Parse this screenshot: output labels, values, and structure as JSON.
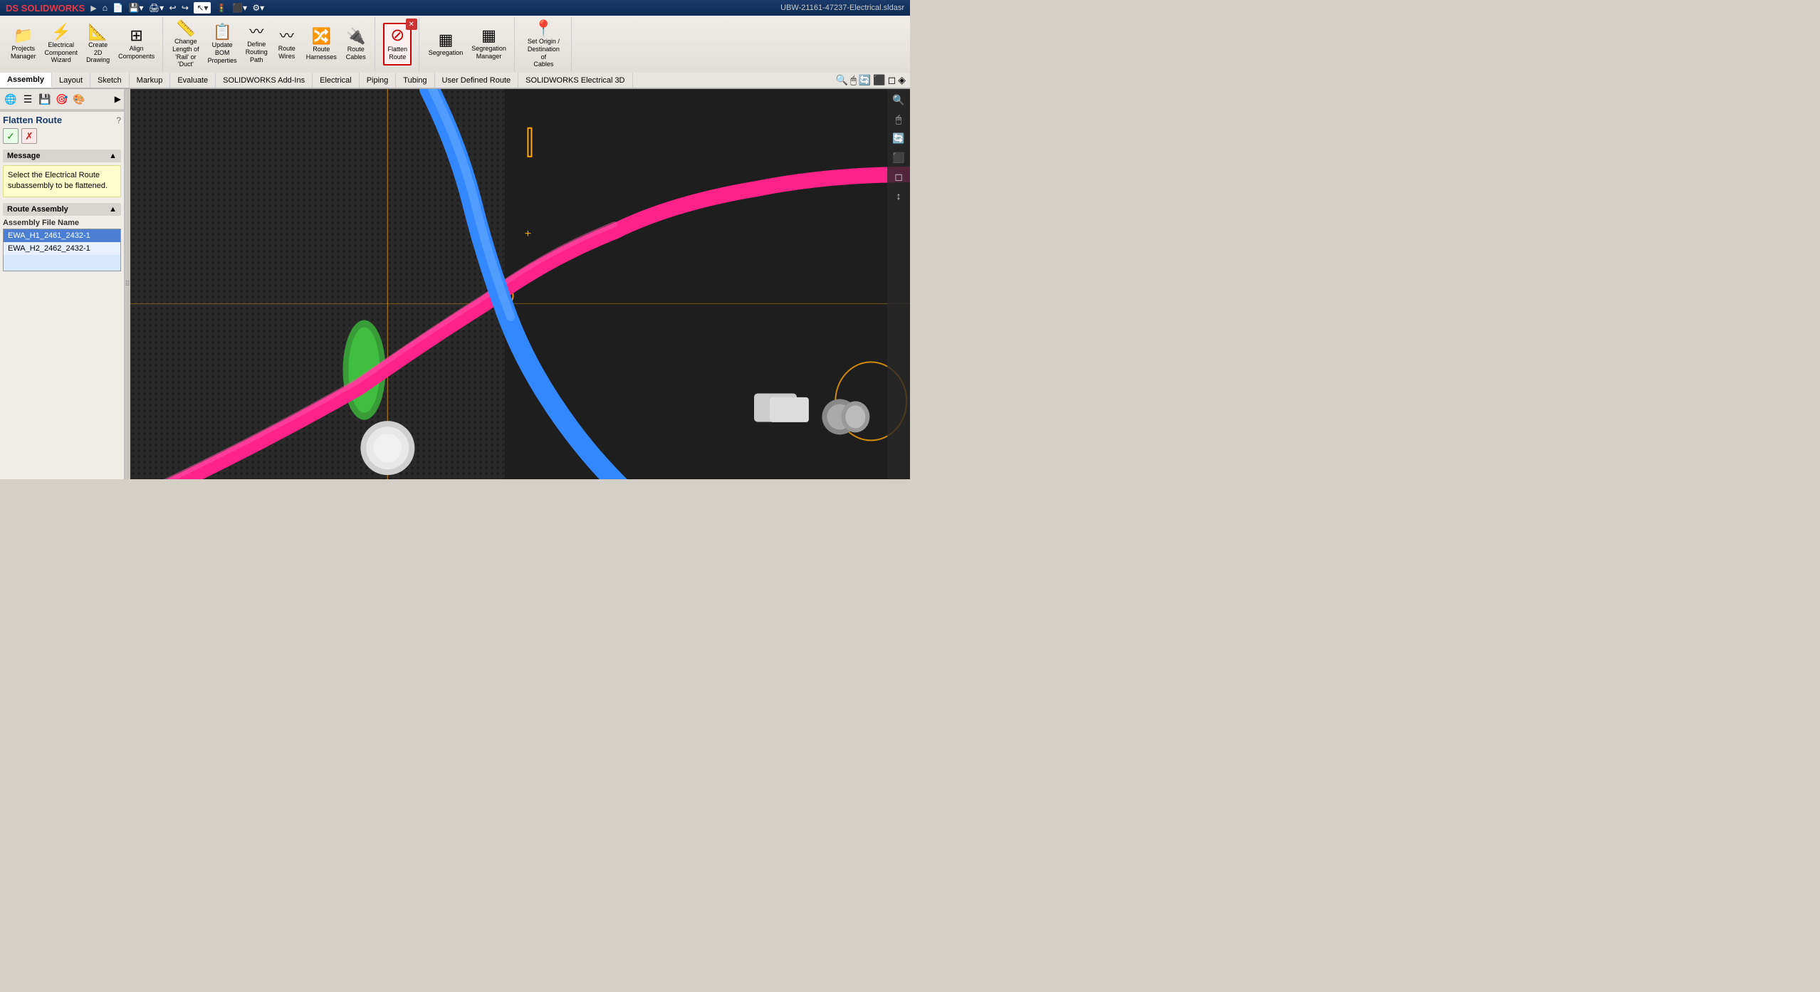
{
  "titlebar": {
    "logo": "DS SOLIDWORKS",
    "filename": "UBW-21161-47237-Electrical.sldasr",
    "nav_arrow": "▶"
  },
  "quick_access": {
    "buttons": [
      "⌂",
      "📄",
      "💾",
      "🖨",
      "↩",
      "↪"
    ]
  },
  "ribbon": {
    "groups": [
      {
        "id": "projects",
        "buttons": [
          {
            "label": "Projects\nManager",
            "icon": "📁"
          },
          {
            "label": "Electrical\nComponent\nWizard",
            "icon": "⚡"
          },
          {
            "label": "Create\n2D\nDrawing",
            "icon": "📐"
          },
          {
            "label": "Align\nComponents",
            "icon": "🔲"
          }
        ]
      },
      {
        "id": "route",
        "buttons": [
          {
            "label": "Change\nLength of\n'Rail' or\n'Duct'",
            "icon": "📏"
          },
          {
            "label": "Update\nBOM\nProperties",
            "icon": "📋"
          },
          {
            "label": "Define\nRouting\nPath",
            "icon": "〰"
          },
          {
            "label": "Route\nWires",
            "icon": "〰"
          },
          {
            "label": "Route\nHarnesses",
            "icon": "🔀"
          },
          {
            "label": "Route\nCables",
            "icon": "🔌"
          }
        ]
      },
      {
        "id": "flatten",
        "buttons": [
          {
            "label": "Flatten\nRoute",
            "icon": "⊘",
            "highlighted": true
          }
        ]
      },
      {
        "id": "segregation",
        "buttons": [
          {
            "label": "Segregation",
            "icon": "▦"
          },
          {
            "label": "Segregation\nManager",
            "icon": "▦"
          }
        ]
      },
      {
        "id": "origin",
        "buttons": [
          {
            "label": "Set Origin /\nDestination of Cables",
            "icon": "📍"
          }
        ]
      }
    ]
  },
  "ribbon_tabs": [
    {
      "label": "Assembly",
      "active": true
    },
    {
      "label": "Layout"
    },
    {
      "label": "Sketch"
    },
    {
      "label": "Markup"
    },
    {
      "label": "Evaluate"
    },
    {
      "label": "SOLIDWORKS Add-Ins"
    },
    {
      "label": "Electrical"
    },
    {
      "label": "Piping"
    },
    {
      "label": "Tubing"
    },
    {
      "label": "User Defined Route"
    },
    {
      "label": "SOLIDWORKS Electrical 3D"
    }
  ],
  "left_panel": {
    "title": "Flatten Route",
    "message": "Select the Electrical Route subassembly to be flattened.",
    "route_assembly_section": "Route Assembly",
    "assembly_file_name_label": "Assembly File Name",
    "assembly_items": [
      {
        "name": "EWA_H1_2461_2432-1",
        "selected": true
      },
      {
        "name": "EWA_H2_2462_2432-1",
        "selected": false
      }
    ],
    "accept_btn": "✓",
    "reject_btn": "✗",
    "collapse_icon": "▲",
    "tools": [
      "🌐",
      "☰",
      "💾",
      "🎯",
      "🎨"
    ]
  },
  "viewport": {
    "background_color": "#1c1c1c",
    "crosshair_color": "#ffa500",
    "has_3d_scene": true
  },
  "right_toolbar": {
    "icons": [
      "🔍",
      "🖱",
      "🔄",
      "⬜",
      "◻",
      "↕"
    ]
  }
}
